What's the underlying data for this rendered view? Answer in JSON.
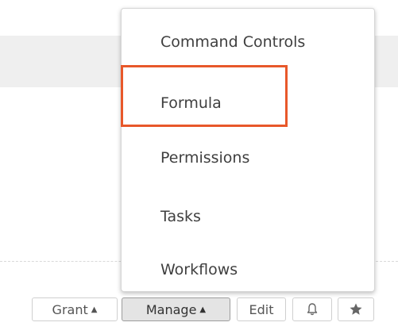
{
  "dropdown": {
    "items": [
      {
        "label": "Command Controls"
      },
      {
        "label": "Formula"
      },
      {
        "label": "Permissions"
      },
      {
        "label": "Tasks"
      },
      {
        "label": "Workflows"
      }
    ],
    "highlighted_item": "Formula",
    "highlight_color": "#e8582a"
  },
  "toolbar": {
    "grant_label": "Grant",
    "manage_label": "Manage",
    "edit_label": "Edit",
    "bell_icon": "bell-icon",
    "star_icon": "star-icon",
    "caret_glyph": "▲"
  }
}
